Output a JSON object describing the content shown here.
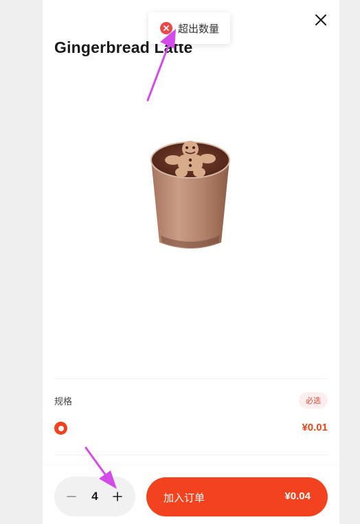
{
  "product": {
    "name": "Gingerbread Latte"
  },
  "toast": {
    "message": "超出数量",
    "icon": "error-circle-icon",
    "color": "#e84a4a"
  },
  "spec": {
    "label": "规格",
    "required_badge": "必选",
    "option_selected": true,
    "option_price": "¥0.01"
  },
  "cart": {
    "quantity": "4",
    "add_label": "加入订单",
    "total_price": "¥0.04"
  },
  "icons": {
    "close": "close-icon",
    "minus": "minus-icon",
    "plus": "plus-icon",
    "arrow": "pointer-arrow-icon"
  },
  "colors": {
    "accent": "#f2431e",
    "arrow": "#d34be8",
    "badge_bg": "#fdeeee"
  }
}
